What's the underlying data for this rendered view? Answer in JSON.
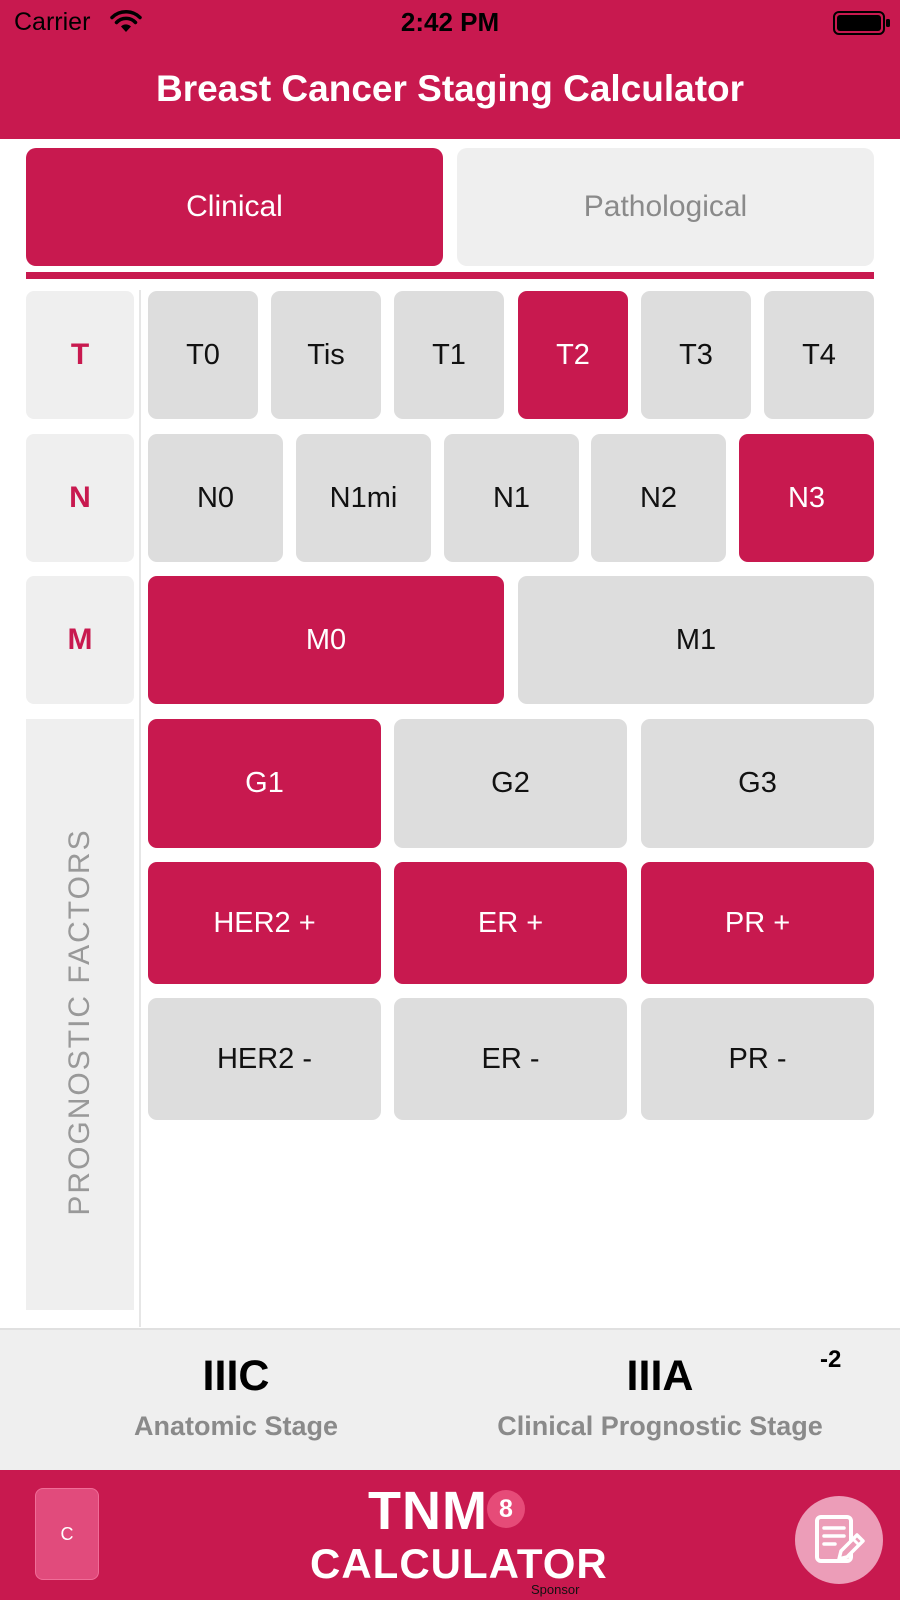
{
  "status_bar": {
    "carrier": "Carrier",
    "time": "2:42 PM"
  },
  "header": {
    "title": "Breast Cancer Staging Calculator"
  },
  "mode_tabs": [
    {
      "label": "Clinical",
      "selected": true
    },
    {
      "label": "Pathological",
      "selected": false
    }
  ],
  "rows": {
    "t": {
      "label": "T",
      "options": [
        "T0",
        "Tis",
        "T1",
        "T2",
        "T3",
        "T4"
      ],
      "selected": "T2"
    },
    "n": {
      "label": "N",
      "options": [
        "N0",
        "N1mi",
        "N1",
        "N2",
        "N3"
      ],
      "selected": "N3"
    },
    "m": {
      "label": "M",
      "options": [
        "M0",
        "M1"
      ],
      "selected": "M0"
    }
  },
  "prognostic": {
    "label": "PROGNOSTIC FACTORS",
    "grade": {
      "options": [
        "G1",
        "G2",
        "G3"
      ],
      "selected": "G1"
    },
    "positive": {
      "options": [
        "HER2 +",
        "ER +",
        "PR +"
      ],
      "selected": [
        "HER2 +",
        "ER +",
        "PR +"
      ]
    },
    "negative": {
      "options": [
        "HER2 -",
        "ER -",
        "PR -"
      ],
      "selected": []
    }
  },
  "results": {
    "anatomic": {
      "value": "IIIC",
      "caption": "Anatomic Stage"
    },
    "prognostic": {
      "value": "IIIA",
      "caption": "Clinical Prognostic Stage",
      "change": "-2"
    }
  },
  "footer": {
    "left_button": "C",
    "logo_line1": "TNM",
    "logo_badge": "8",
    "logo_line2": "CALCULATOR",
    "sponsor": "Sponsor"
  },
  "colors": {
    "accent": "#c8194f",
    "unselected": "#dddddd",
    "panel": "#efefef"
  },
  "icons": {
    "wifi": "wifi-icon",
    "battery": "battery-icon",
    "notes": "notes-edit-icon"
  }
}
